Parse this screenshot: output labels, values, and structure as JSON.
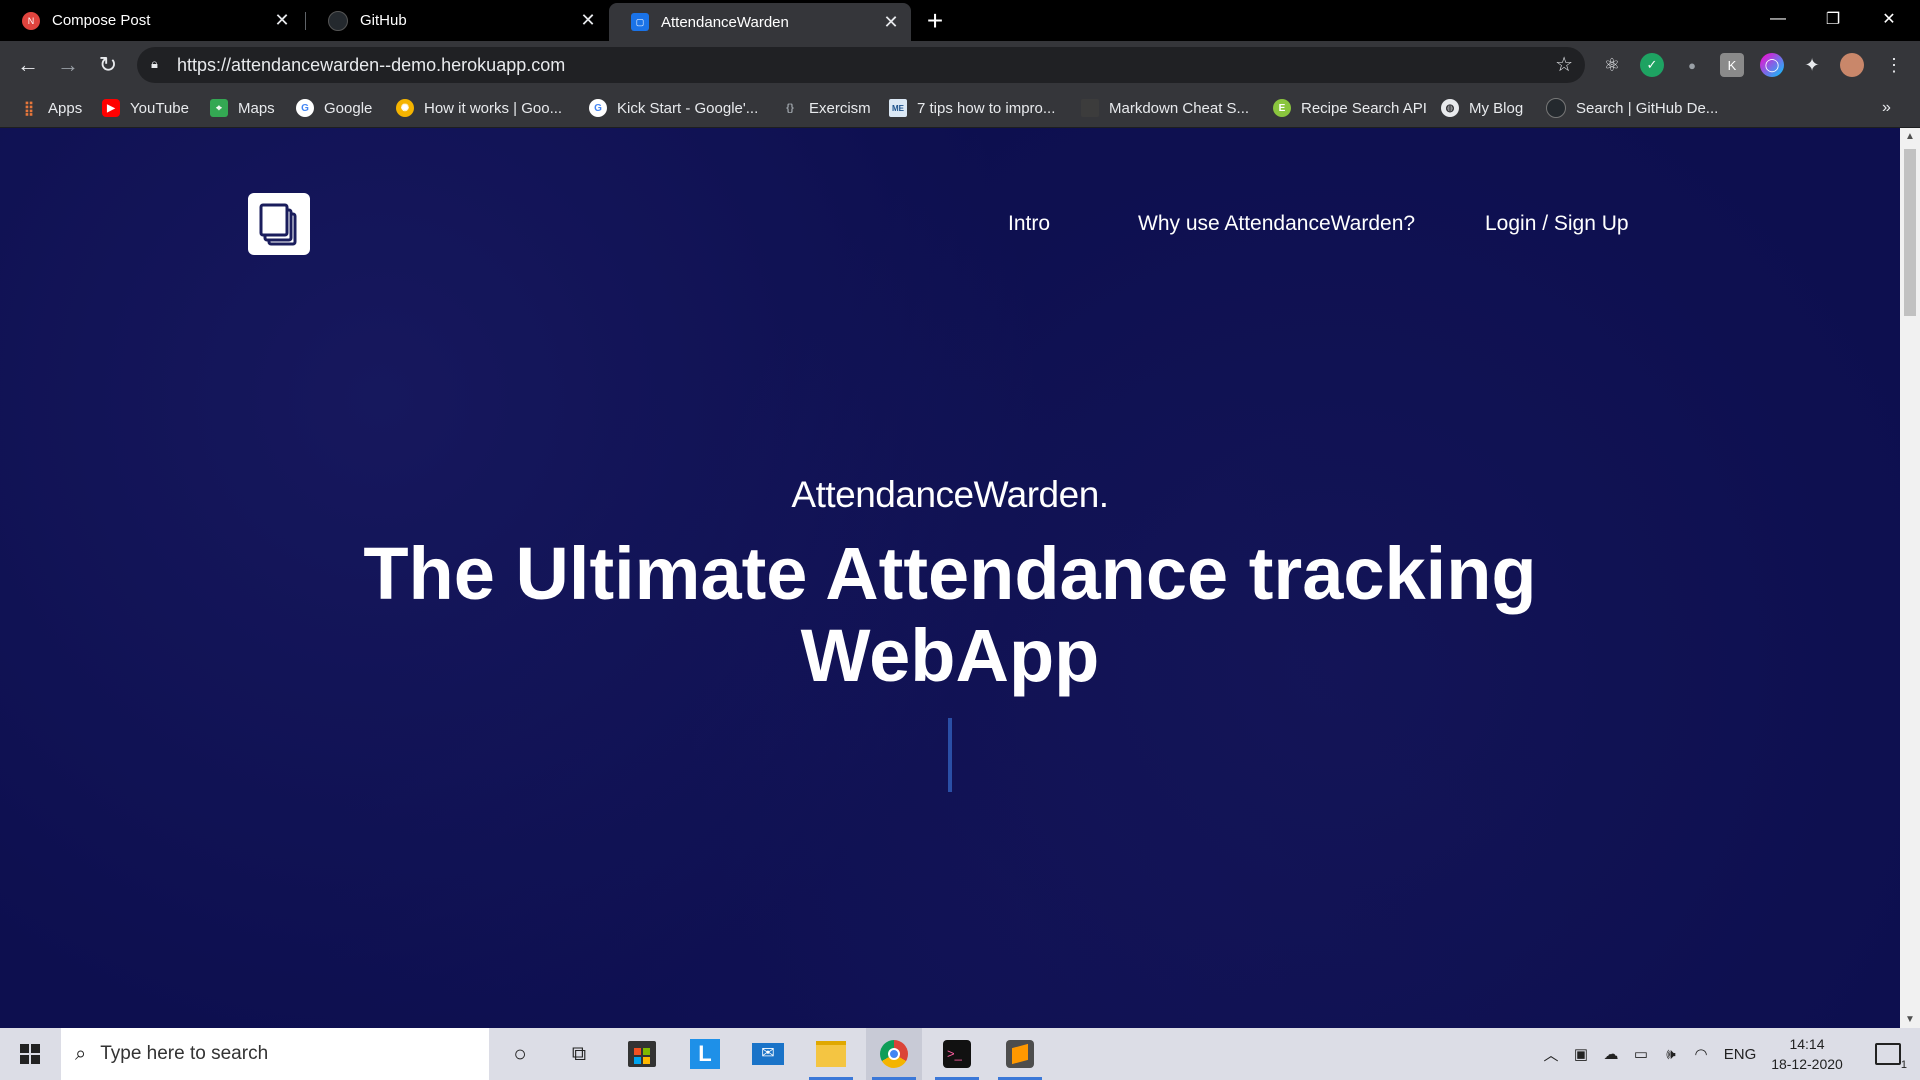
{
  "browser": {
    "tabs": [
      {
        "title": "Compose Post",
        "favicon": "notion-like-red-icon",
        "active": false
      },
      {
        "title": "GitHub",
        "favicon": "github-icon",
        "active": false
      },
      {
        "title": "AttendanceWarden",
        "favicon": "page-icon",
        "active": true
      }
    ],
    "url": "https://attendancewarden--demo.herokuapp.com",
    "bookmarks": [
      {
        "label": "Apps",
        "icon": "apps-grid-icon"
      },
      {
        "label": "YouTube",
        "icon": "youtube-icon"
      },
      {
        "label": "Maps",
        "icon": "maps-icon"
      },
      {
        "label": "Google",
        "icon": "google-icon"
      },
      {
        "label": "How it works | Goo...",
        "icon": "sun-icon"
      },
      {
        "label": "Kick Start - Google'...",
        "icon": "google-icon"
      },
      {
        "label": "Exercism",
        "icon": "exercism-icon"
      },
      {
        "label": "7 tips how to impro...",
        "icon": "me-icon"
      },
      {
        "label": "Markdown Cheat S...",
        "icon": "markdown-icon"
      },
      {
        "label": "Recipe Search API",
        "icon": "edamam-icon"
      },
      {
        "label": "My Blog",
        "icon": "globe-icon"
      },
      {
        "label": "Search | GitHub De...",
        "icon": "github-icon"
      }
    ]
  },
  "page": {
    "nav": {
      "intro": "Intro",
      "why": "Why use AttendanceWarden?",
      "login": "Login / Sign Up"
    },
    "brand": "AttendanceWarden.",
    "headline": "The Ultimate Attendance tracking WebApp",
    "background_color": "#0d0f4f"
  },
  "taskbar": {
    "search_placeholder": "Type here to search",
    "language": "ENG",
    "time": "14:14",
    "date": "18-12-2020",
    "notification_count": "1"
  }
}
